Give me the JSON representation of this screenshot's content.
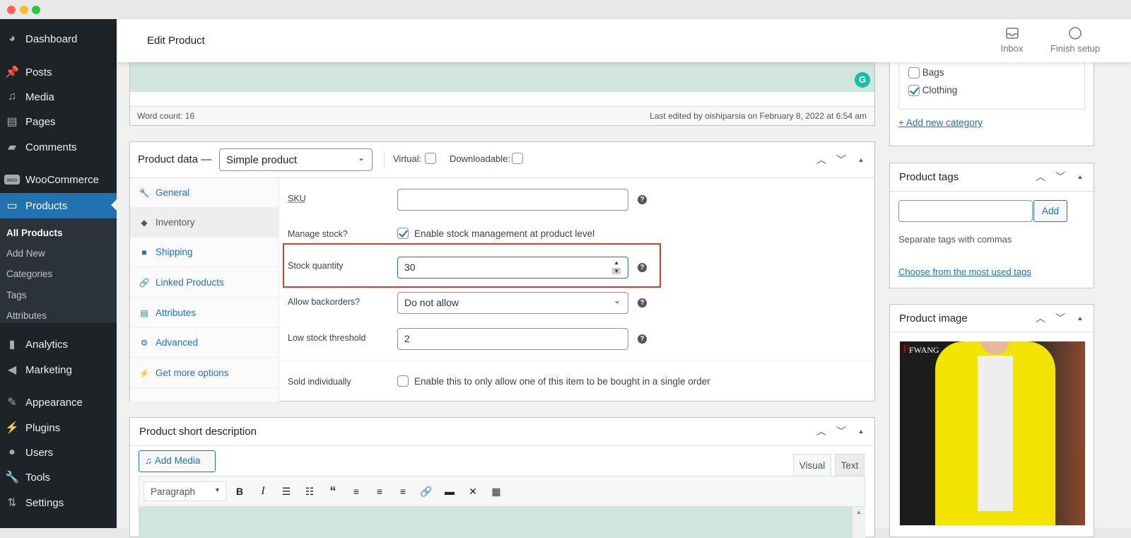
{
  "window": {
    "controls": [
      "close",
      "minimize",
      "maximize"
    ]
  },
  "sidebar": {
    "items": [
      {
        "label": "Dashboard",
        "icon": "dashboard-icon"
      },
      {
        "label": "Posts",
        "icon": "pin-icon"
      },
      {
        "label": "Media",
        "icon": "media-icon"
      },
      {
        "label": "Pages",
        "icon": "pages-icon"
      },
      {
        "label": "Comments",
        "icon": "comment-icon"
      },
      {
        "label": "WooCommerce",
        "icon": "woo-icon"
      },
      {
        "label": "Products",
        "icon": "archive-icon",
        "active": true
      },
      {
        "label": "Analytics",
        "icon": "bar-chart-icon"
      },
      {
        "label": "Marketing",
        "icon": "megaphone-icon"
      },
      {
        "label": "Appearance",
        "icon": "paintbrush-icon"
      },
      {
        "label": "Plugins",
        "icon": "plug-icon"
      },
      {
        "label": "Users",
        "icon": "user-icon"
      },
      {
        "label": "Tools",
        "icon": "wrench-icon"
      },
      {
        "label": "Settings",
        "icon": "sliders-icon"
      }
    ],
    "submenu": [
      "All Products",
      "Add New",
      "Categories",
      "Tags",
      "Attributes"
    ]
  },
  "topbar": {
    "title": "Edit Product",
    "inbox": "Inbox",
    "finish_setup": "Finish setup"
  },
  "editor": {
    "word_count": "Word count: 16",
    "last_edited": "Last edited by oishiparsia on February 8, 2022 at 6:54 am"
  },
  "product_data": {
    "title": "Product data —",
    "type": "Simple product",
    "virtual_label": "Virtual:",
    "downloadable_label": "Downloadable:",
    "tabs": [
      {
        "label": "General",
        "icon": "wrench-icon"
      },
      {
        "label": "Inventory",
        "icon": "tag-icon",
        "selected": true
      },
      {
        "label": "Shipping",
        "icon": "truck-icon"
      },
      {
        "label": "Linked Products",
        "icon": "link-icon"
      },
      {
        "label": "Attributes",
        "icon": "list-icon"
      },
      {
        "label": "Advanced",
        "icon": "gear-icon"
      },
      {
        "label": "Get more options",
        "icon": "plugin-icon"
      }
    ],
    "fields": {
      "sku_label": "SKU",
      "sku_value": "",
      "manage_stock_label": "Manage stock?",
      "manage_stock_text": "Enable stock management at product level",
      "manage_stock_checked": true,
      "stock_qty_label": "Stock quantity",
      "stock_qty_value": "30",
      "backorders_label": "Allow backorders?",
      "backorders_value": "Do not allow",
      "low_stock_label": "Low stock threshold",
      "low_stock_value": "2",
      "sold_individually_label": "Sold individually",
      "sold_individually_text": "Enable this to only allow one of this item to be bought in a single order",
      "sold_individually_checked": false
    },
    "highlight_color": "#e03a2f"
  },
  "short_description": {
    "title": "Product short description",
    "add_media": "Add Media",
    "tab_visual": "Visual",
    "tab_text": "Text",
    "format": "Paragraph",
    "toolbar": [
      "bold-icon",
      "italic-icon",
      "bullet-list-icon",
      "numbered-list-icon",
      "blockquote-icon",
      "align-left-icon",
      "align-center-icon",
      "align-right-icon",
      "link-icon",
      "read-more-icon",
      "fullscreen-icon",
      "toolbar-toggle-icon"
    ]
  },
  "categories": {
    "items": [
      {
        "label": "Bags",
        "checked": false
      },
      {
        "label": "Clothing",
        "checked": true
      }
    ],
    "add_new": "+ Add new category"
  },
  "tags": {
    "title": "Product tags",
    "add": "Add",
    "hint": "Separate tags with commas",
    "choose": "Choose from the most used tags",
    "input_value": ""
  },
  "product_image": {
    "title": "Product image",
    "brand_text": "FWANG"
  },
  "colors": {
    "accent": "#2271b1",
    "sidebar_bg": "#1e2327",
    "editor_green": "#d1e4dd",
    "grammarly": "#15c39a"
  }
}
